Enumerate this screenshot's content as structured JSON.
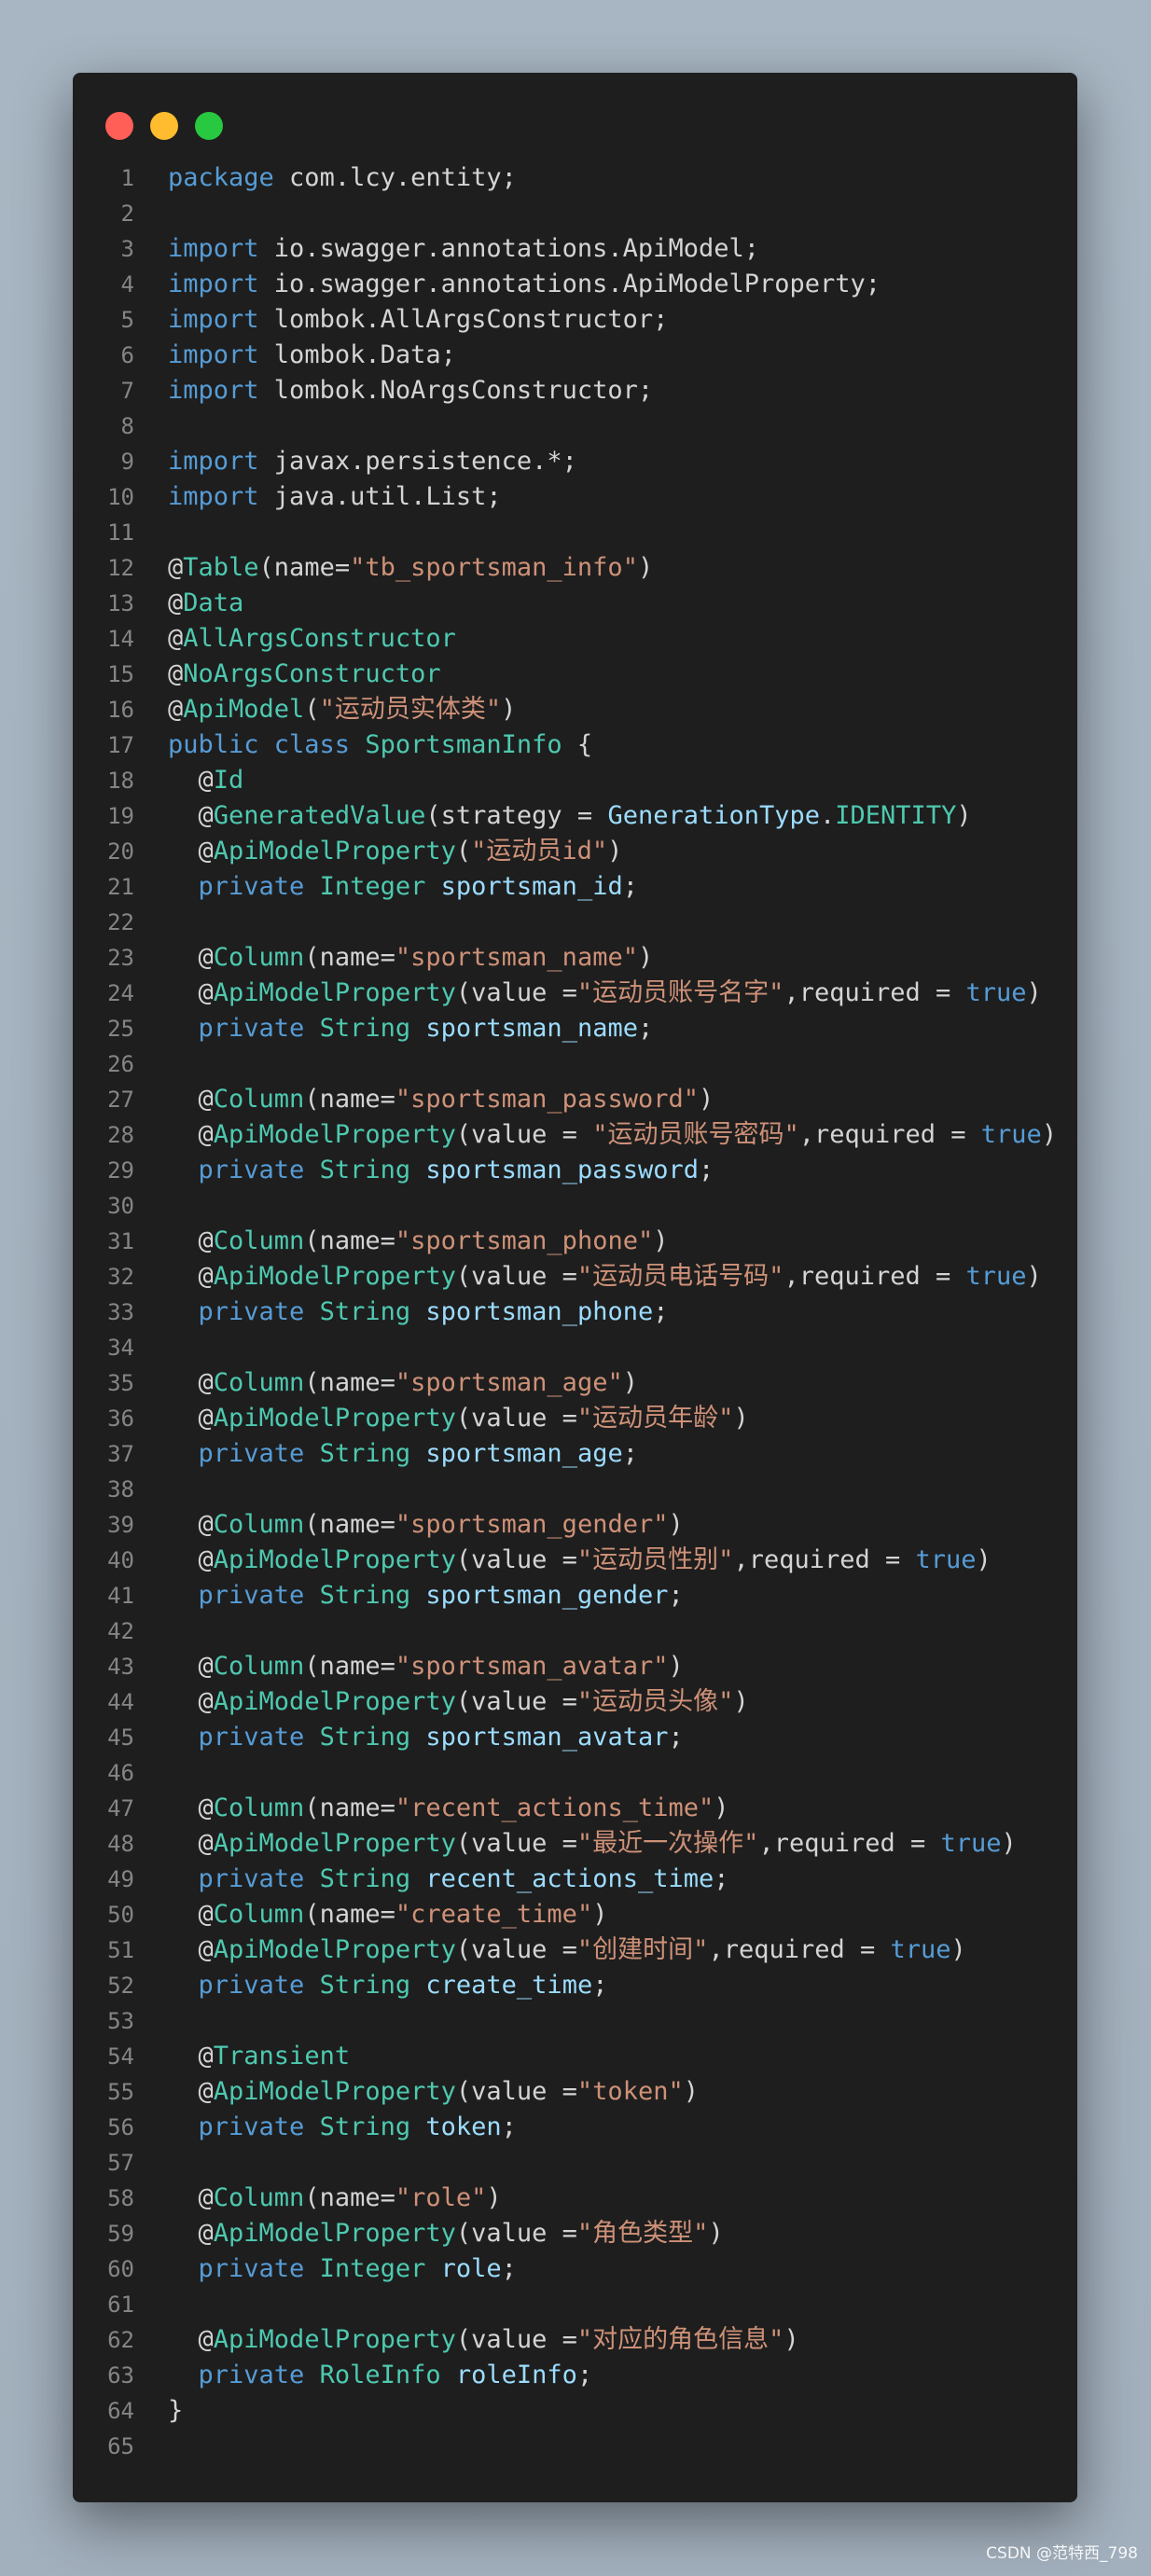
{
  "window": {
    "buttons": [
      {
        "name": "close",
        "color": "#ff5f57"
      },
      {
        "name": "minimize",
        "color": "#febc2e"
      },
      {
        "name": "maximize",
        "color": "#28c840"
      }
    ]
  },
  "colors": {
    "default": "#d4d4d4",
    "keyword": "#569cd6",
    "annotation": "#4ec9b0",
    "string": "#ce9178",
    "variable": "#9cdcfe",
    "line_number": "#858585"
  },
  "code": {
    "lines": [
      [
        [
          "kw",
          "package"
        ],
        [
          "t",
          " com.lcy.entity;"
        ]
      ],
      [],
      [
        [
          "kw",
          "import"
        ],
        [
          "t",
          " io.swagger.annotations.ApiModel;"
        ]
      ],
      [
        [
          "kw",
          "import"
        ],
        [
          "t",
          " io.swagger.annotations.ApiModelProperty;"
        ]
      ],
      [
        [
          "kw",
          "import"
        ],
        [
          "t",
          " lombok.AllArgsConstructor;"
        ]
      ],
      [
        [
          "kw",
          "import"
        ],
        [
          "t",
          " lombok.Data;"
        ]
      ],
      [
        [
          "kw",
          "import"
        ],
        [
          "t",
          " lombok.NoArgsConstructor;"
        ]
      ],
      [],
      [
        [
          "kw",
          "import"
        ],
        [
          "t",
          " javax.persistence.*;"
        ]
      ],
      [
        [
          "kw",
          "import"
        ],
        [
          "t",
          " java.util.List;"
        ]
      ],
      [],
      [
        [
          "t",
          "@"
        ],
        [
          "an",
          "Table"
        ],
        [
          "t",
          "(name="
        ],
        [
          "str",
          "\"tb_sportsman_info\""
        ],
        [
          "t",
          ")"
        ]
      ],
      [
        [
          "t",
          "@"
        ],
        [
          "an",
          "Data"
        ]
      ],
      [
        [
          "t",
          "@"
        ],
        [
          "an",
          "AllArgsConstructor"
        ]
      ],
      [
        [
          "t",
          "@"
        ],
        [
          "an",
          "NoArgsConstructor"
        ]
      ],
      [
        [
          "t",
          "@"
        ],
        [
          "an",
          "ApiModel"
        ],
        [
          "t",
          "("
        ],
        [
          "str",
          "\"运动员实体类\""
        ],
        [
          "t",
          ")"
        ]
      ],
      [
        [
          "kw",
          "public class"
        ],
        [
          "t",
          " "
        ],
        [
          "an",
          "SportsmanInfo"
        ],
        [
          "t",
          " {"
        ]
      ],
      [
        [
          "t",
          "  @"
        ],
        [
          "an",
          "Id"
        ]
      ],
      [
        [
          "t",
          "  @"
        ],
        [
          "an",
          "GeneratedValue"
        ],
        [
          "t",
          "(strategy = "
        ],
        [
          "var",
          "GenerationType"
        ],
        [
          "t",
          "."
        ],
        [
          "an",
          "IDENTITY"
        ],
        [
          "t",
          ")"
        ]
      ],
      [
        [
          "t",
          "  @"
        ],
        [
          "an",
          "ApiModelProperty"
        ],
        [
          "t",
          "("
        ],
        [
          "str",
          "\"运动员id\""
        ],
        [
          "t",
          ")"
        ]
      ],
      [
        [
          "t",
          "  "
        ],
        [
          "kw",
          "private"
        ],
        [
          "t",
          " "
        ],
        [
          "an",
          "Integer"
        ],
        [
          "t",
          " "
        ],
        [
          "var",
          "sportsman_id"
        ],
        [
          "t",
          ";"
        ]
      ],
      [],
      [
        [
          "t",
          "  @"
        ],
        [
          "an",
          "Column"
        ],
        [
          "t",
          "(name="
        ],
        [
          "str",
          "\"sportsman_name\""
        ],
        [
          "t",
          ")"
        ]
      ],
      [
        [
          "t",
          "  @"
        ],
        [
          "an",
          "ApiModelProperty"
        ],
        [
          "t",
          "(value ="
        ],
        [
          "str",
          "\"运动员账号名字\""
        ],
        [
          "t",
          ",required = "
        ],
        [
          "kw",
          "true"
        ],
        [
          "t",
          ")"
        ]
      ],
      [
        [
          "t",
          "  "
        ],
        [
          "kw",
          "private"
        ],
        [
          "t",
          " "
        ],
        [
          "an",
          "String"
        ],
        [
          "t",
          " "
        ],
        [
          "var",
          "sportsman_name"
        ],
        [
          "t",
          ";"
        ]
      ],
      [],
      [
        [
          "t",
          "  @"
        ],
        [
          "an",
          "Column"
        ],
        [
          "t",
          "(name="
        ],
        [
          "str",
          "\"sportsman_password\""
        ],
        [
          "t",
          ")"
        ]
      ],
      [
        [
          "t",
          "  @"
        ],
        [
          "an",
          "ApiModelProperty"
        ],
        [
          "t",
          "(value = "
        ],
        [
          "str",
          "\"运动员账号密码\""
        ],
        [
          "t",
          ",required = "
        ],
        [
          "kw",
          "true"
        ],
        [
          "t",
          ")"
        ]
      ],
      [
        [
          "t",
          "  "
        ],
        [
          "kw",
          "private"
        ],
        [
          "t",
          " "
        ],
        [
          "an",
          "String"
        ],
        [
          "t",
          " "
        ],
        [
          "var",
          "sportsman_password"
        ],
        [
          "t",
          ";"
        ]
      ],
      [],
      [
        [
          "t",
          "  @"
        ],
        [
          "an",
          "Column"
        ],
        [
          "t",
          "(name="
        ],
        [
          "str",
          "\"sportsman_phone\""
        ],
        [
          "t",
          ")"
        ]
      ],
      [
        [
          "t",
          "  @"
        ],
        [
          "an",
          "ApiModelProperty"
        ],
        [
          "t",
          "(value ="
        ],
        [
          "str",
          "\"运动员电话号码\""
        ],
        [
          "t",
          ",required = "
        ],
        [
          "kw",
          "true"
        ],
        [
          "t",
          ")"
        ]
      ],
      [
        [
          "t",
          "  "
        ],
        [
          "kw",
          "private"
        ],
        [
          "t",
          " "
        ],
        [
          "an",
          "String"
        ],
        [
          "t",
          " "
        ],
        [
          "var",
          "sportsman_phone"
        ],
        [
          "t",
          ";"
        ]
      ],
      [],
      [
        [
          "t",
          "  @"
        ],
        [
          "an",
          "Column"
        ],
        [
          "t",
          "(name="
        ],
        [
          "str",
          "\"sportsman_age\""
        ],
        [
          "t",
          ")"
        ]
      ],
      [
        [
          "t",
          "  @"
        ],
        [
          "an",
          "ApiModelProperty"
        ],
        [
          "t",
          "(value ="
        ],
        [
          "str",
          "\"运动员年龄\""
        ],
        [
          "t",
          ")"
        ]
      ],
      [
        [
          "t",
          "  "
        ],
        [
          "kw",
          "private"
        ],
        [
          "t",
          " "
        ],
        [
          "an",
          "String"
        ],
        [
          "t",
          " "
        ],
        [
          "var",
          "sportsman_age"
        ],
        [
          "t",
          ";"
        ]
      ],
      [],
      [
        [
          "t",
          "  @"
        ],
        [
          "an",
          "Column"
        ],
        [
          "t",
          "(name="
        ],
        [
          "str",
          "\"sportsman_gender\""
        ],
        [
          "t",
          ")"
        ]
      ],
      [
        [
          "t",
          "  @"
        ],
        [
          "an",
          "ApiModelProperty"
        ],
        [
          "t",
          "(value ="
        ],
        [
          "str",
          "\"运动员性别\""
        ],
        [
          "t",
          ",required = "
        ],
        [
          "kw",
          "true"
        ],
        [
          "t",
          ")"
        ]
      ],
      [
        [
          "t",
          "  "
        ],
        [
          "kw",
          "private"
        ],
        [
          "t",
          " "
        ],
        [
          "an",
          "String"
        ],
        [
          "t",
          " "
        ],
        [
          "var",
          "sportsman_gender"
        ],
        [
          "t",
          ";"
        ]
      ],
      [],
      [
        [
          "t",
          "  @"
        ],
        [
          "an",
          "Column"
        ],
        [
          "t",
          "(name="
        ],
        [
          "str",
          "\"sportsman_avatar\""
        ],
        [
          "t",
          ")"
        ]
      ],
      [
        [
          "t",
          "  @"
        ],
        [
          "an",
          "ApiModelProperty"
        ],
        [
          "t",
          "(value ="
        ],
        [
          "str",
          "\"运动员头像\""
        ],
        [
          "t",
          ")"
        ]
      ],
      [
        [
          "t",
          "  "
        ],
        [
          "kw",
          "private"
        ],
        [
          "t",
          " "
        ],
        [
          "an",
          "String"
        ],
        [
          "t",
          " "
        ],
        [
          "var",
          "sportsman_avatar"
        ],
        [
          "t",
          ";"
        ]
      ],
      [],
      [
        [
          "t",
          "  @"
        ],
        [
          "an",
          "Column"
        ],
        [
          "t",
          "(name="
        ],
        [
          "str",
          "\"recent_actions_time\""
        ],
        [
          "t",
          ")"
        ]
      ],
      [
        [
          "t",
          "  @"
        ],
        [
          "an",
          "ApiModelProperty"
        ],
        [
          "t",
          "(value ="
        ],
        [
          "str",
          "\"最近一次操作\""
        ],
        [
          "t",
          ",required = "
        ],
        [
          "kw",
          "true"
        ],
        [
          "t",
          ")"
        ]
      ],
      [
        [
          "t",
          "  "
        ],
        [
          "kw",
          "private"
        ],
        [
          "t",
          " "
        ],
        [
          "an",
          "String"
        ],
        [
          "t",
          " "
        ],
        [
          "var",
          "recent_actions_time"
        ],
        [
          "t",
          ";"
        ]
      ],
      [
        [
          "t",
          "  @"
        ],
        [
          "an",
          "Column"
        ],
        [
          "t",
          "(name="
        ],
        [
          "str",
          "\"create_time\""
        ],
        [
          "t",
          ")"
        ]
      ],
      [
        [
          "t",
          "  @"
        ],
        [
          "an",
          "ApiModelProperty"
        ],
        [
          "t",
          "(value ="
        ],
        [
          "str",
          "\"创建时间\""
        ],
        [
          "t",
          ",required = "
        ],
        [
          "kw",
          "true"
        ],
        [
          "t",
          ")"
        ]
      ],
      [
        [
          "t",
          "  "
        ],
        [
          "kw",
          "private"
        ],
        [
          "t",
          " "
        ],
        [
          "an",
          "String"
        ],
        [
          "t",
          " "
        ],
        [
          "var",
          "create_time"
        ],
        [
          "t",
          ";"
        ]
      ],
      [],
      [
        [
          "t",
          "  @"
        ],
        [
          "an",
          "Transient"
        ]
      ],
      [
        [
          "t",
          "  @"
        ],
        [
          "an",
          "ApiModelProperty"
        ],
        [
          "t",
          "(value ="
        ],
        [
          "str",
          "\"token\""
        ],
        [
          "t",
          ")"
        ]
      ],
      [
        [
          "t",
          "  "
        ],
        [
          "kw",
          "private"
        ],
        [
          "t",
          " "
        ],
        [
          "an",
          "String"
        ],
        [
          "t",
          " "
        ],
        [
          "var",
          "token"
        ],
        [
          "t",
          ";"
        ]
      ],
      [],
      [
        [
          "t",
          "  @"
        ],
        [
          "an",
          "Column"
        ],
        [
          "t",
          "(name="
        ],
        [
          "str",
          "\"role\""
        ],
        [
          "t",
          ")"
        ]
      ],
      [
        [
          "t",
          "  @"
        ],
        [
          "an",
          "ApiModelProperty"
        ],
        [
          "t",
          "(value ="
        ],
        [
          "str",
          "\"角色类型\""
        ],
        [
          "t",
          ")"
        ]
      ],
      [
        [
          "t",
          "  "
        ],
        [
          "kw",
          "private"
        ],
        [
          "t",
          " "
        ],
        [
          "an",
          "Integer"
        ],
        [
          "t",
          " "
        ],
        [
          "var",
          "role"
        ],
        [
          "t",
          ";"
        ]
      ],
      [],
      [
        [
          "t",
          "  @"
        ],
        [
          "an",
          "ApiModelProperty"
        ],
        [
          "t",
          "(value ="
        ],
        [
          "str",
          "\"对应的角色信息\""
        ],
        [
          "t",
          ")"
        ]
      ],
      [
        [
          "t",
          "  "
        ],
        [
          "kw",
          "private"
        ],
        [
          "t",
          " "
        ],
        [
          "an",
          "RoleInfo"
        ],
        [
          "t",
          " "
        ],
        [
          "var",
          "roleInfo"
        ],
        [
          "t",
          ";"
        ]
      ],
      [
        [
          "t",
          "}"
        ]
      ],
      []
    ]
  },
  "watermark": "CSDN @范特西_798"
}
